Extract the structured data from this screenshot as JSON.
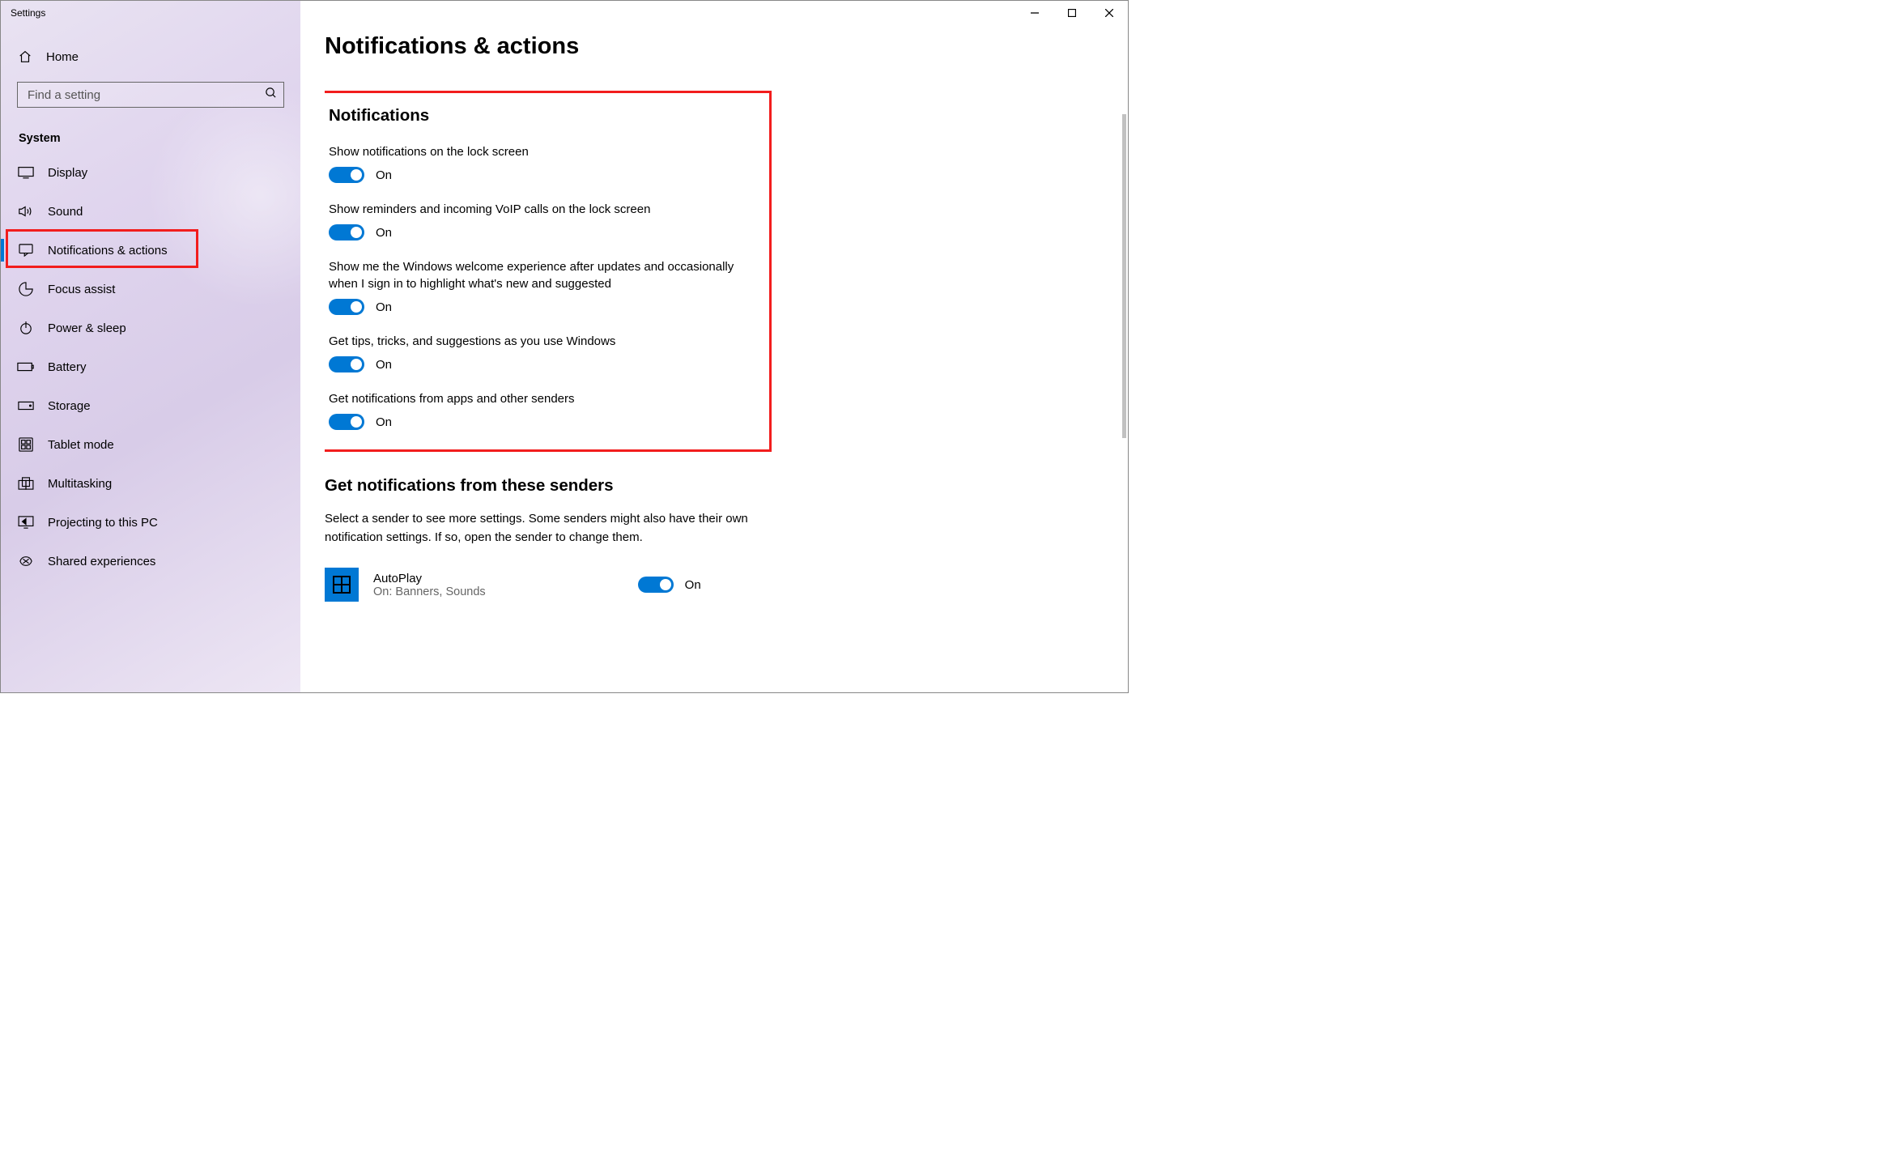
{
  "window": {
    "title": "Settings"
  },
  "sidebar": {
    "home": "Home",
    "search_placeholder": "Find a setting",
    "section": "System",
    "items": [
      {
        "label": "Display",
        "icon": "display"
      },
      {
        "label": "Sound",
        "icon": "sound"
      },
      {
        "label": "Notifications & actions",
        "icon": "notifications",
        "active": true,
        "highlighted": true
      },
      {
        "label": "Focus assist",
        "icon": "focus"
      },
      {
        "label": "Power & sleep",
        "icon": "power"
      },
      {
        "label": "Battery",
        "icon": "battery"
      },
      {
        "label": "Storage",
        "icon": "storage"
      },
      {
        "label": "Tablet mode",
        "icon": "tablet"
      },
      {
        "label": "Multitasking",
        "icon": "multitasking"
      },
      {
        "label": "Projecting to this PC",
        "icon": "projecting"
      },
      {
        "label": "Shared experiences",
        "icon": "shared"
      }
    ]
  },
  "main": {
    "title": "Notifications & actions",
    "notifications_heading": "Notifications",
    "settings": [
      {
        "label": "Show notifications on the lock screen",
        "state": "On"
      },
      {
        "label": "Show reminders and incoming VoIP calls on the lock screen",
        "state": "On"
      },
      {
        "label": "Show me the Windows welcome experience after updates and occasionally when I sign in to highlight what's new and suggested",
        "state": "On"
      },
      {
        "label": "Get tips, tricks, and suggestions as you use Windows",
        "state": "On"
      },
      {
        "label": "Get notifications from apps and other senders",
        "state": "On"
      }
    ],
    "senders_heading": "Get notifications from these senders",
    "senders_desc": "Select a sender to see more settings. Some senders might also have their own notification settings. If so, open the sender to change them.",
    "senders": [
      {
        "name": "AutoPlay",
        "status": "On: Banners, Sounds",
        "toggle_state": "On"
      }
    ]
  }
}
